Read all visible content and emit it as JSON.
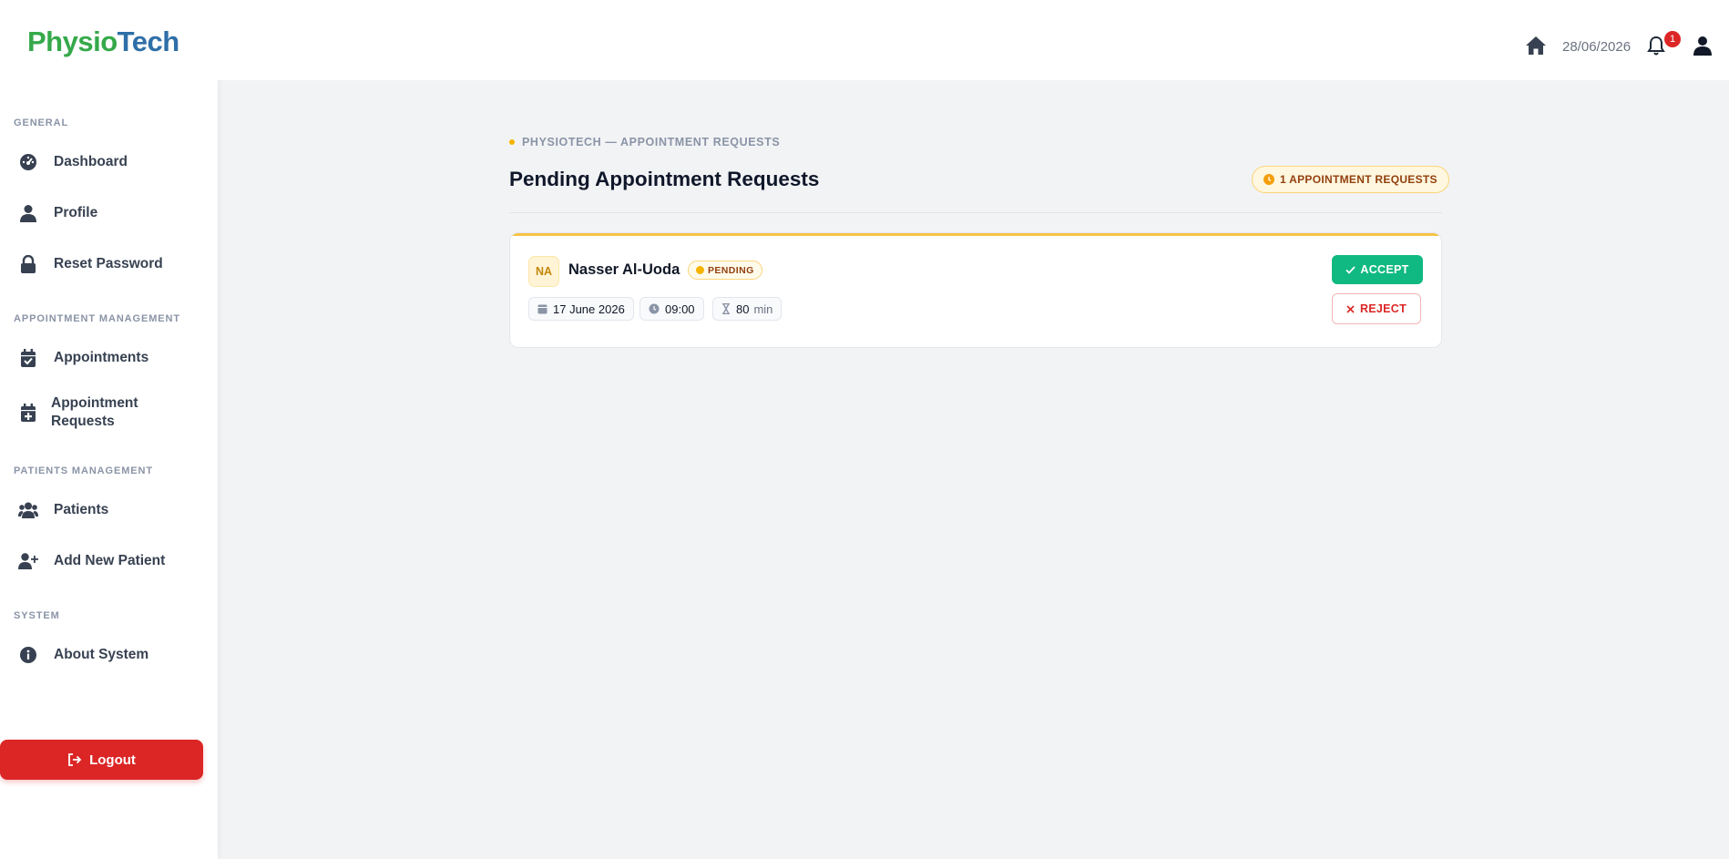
{
  "brand": {
    "name_part1": "Physio",
    "name_part2": "Tech"
  },
  "sidebar": {
    "sections": [
      {
        "title": "GENERAL"
      },
      {
        "title": "APPOINTMENT MANAGEMENT"
      },
      {
        "title": "PATIENTS MANAGEMENT"
      },
      {
        "title": "SYSTEM"
      }
    ],
    "items": [
      {
        "label": "Dashboard",
        "icon": "dashboard-gauge-icon"
      },
      {
        "label": "Profile",
        "icon": "user-icon"
      },
      {
        "label": "Reset Password",
        "icon": "lock-icon"
      },
      {
        "label": "Appointments",
        "icon": "calendar-check-icon"
      },
      {
        "label": "Appointment Requests",
        "icon": "calendar-plus-icon"
      },
      {
        "label": "Patients",
        "icon": "users-icon"
      },
      {
        "label": "Add New Patient",
        "icon": "user-plus-icon"
      },
      {
        "label": "About System",
        "icon": "info-circle-icon"
      }
    ],
    "logout_label": "Logout"
  },
  "topbar": {
    "date": "28/06/2026",
    "notification_count": "1"
  },
  "main": {
    "kicker": "PHYSIOTECH — APPOINTMENT REQUESTS",
    "title": "Pending Appointment Requests",
    "count_label": "1 APPOINTMENT REQUESTS",
    "requests": [
      {
        "initials": "NA",
        "name": "Nasser Al-Uoda",
        "status": "PENDING",
        "date": "17 June 2026",
        "time": "09:00",
        "duration": "80",
        "duration_unit": "min",
        "accept_label": "ACCEPT",
        "reject_label": "REJECT"
      }
    ]
  },
  "colors": {
    "accent": "#f5b400",
    "accept": "#10b981",
    "danger": "#dc2626"
  }
}
